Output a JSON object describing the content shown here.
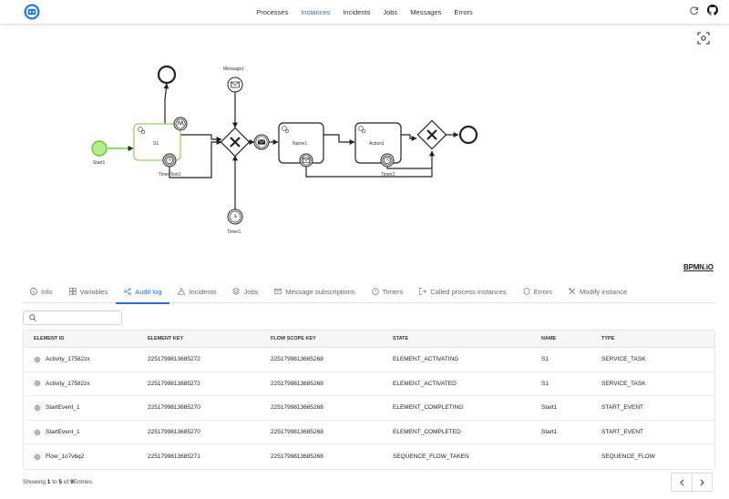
{
  "nav": {
    "links": [
      "Processes",
      "Instances",
      "Incidents",
      "Jobs",
      "Messages",
      "Errors"
    ],
    "active": "Instances",
    "icons": [
      "zeebe-logo-icon",
      "refresh-icon",
      "github-icon"
    ]
  },
  "diagram": {
    "labels": {
      "start1": "Start1",
      "s1": "S1",
      "timertest1": "TimerTest1",
      "message1": "Message1",
      "name1": "Name1",
      "action1": "Action1",
      "timer2": "Timer2",
      "timer1": "Timer1"
    },
    "watermark": "BPMN.iO",
    "active_color": "#52c41a"
  },
  "tabs": [
    {
      "label": "Info",
      "icon": "info-icon"
    },
    {
      "label": "Variables",
      "icon": "variables-icon"
    },
    {
      "label": "Audit log",
      "icon": "share-icon"
    },
    {
      "label": "Incidents",
      "icon": "warning-icon"
    },
    {
      "label": "Jobs",
      "icon": "jobs-icon"
    },
    {
      "label": "Message subscriptions",
      "icon": "mail-icon"
    },
    {
      "label": "Timers",
      "icon": "clock-icon"
    },
    {
      "label": "Called process instances",
      "icon": "external-icon"
    },
    {
      "label": "Errors",
      "icon": "shield-icon"
    },
    {
      "label": "Modify instance",
      "icon": "tools-icon"
    }
  ],
  "active_tab": "Audit log",
  "search": {
    "placeholder": "",
    "value": ""
  },
  "table": {
    "columns": [
      "ELEMENT ID",
      "ELEMENT KEY",
      "FLOW SCOPE KEY",
      "STATE",
      "NAME",
      "TYPE"
    ],
    "rows": [
      [
        "Activity_17582zx",
        "2251799813685272",
        "2251799813685268",
        "ELEMENT_ACTIVATING",
        "S1",
        "SERVICE_TASK"
      ],
      [
        "Activity_17582zx",
        "2251799813685272",
        "2251799813685268",
        "ELEMENT_ACTIVATED",
        "S1",
        "SERVICE_TASK"
      ],
      [
        "StartEvent_1",
        "2251799813685270",
        "2251799813685268",
        "ELEMENT_COMPLETING",
        "Start1",
        "START_EVENT"
      ],
      [
        "StartEvent_1",
        "2251799813685270",
        "2251799813685268",
        "ELEMENT_COMPLETED",
        "Start1",
        "START_EVENT"
      ],
      [
        "Flow_1o7v6q2",
        "2251799813685271",
        "2251799813685268",
        "SEQUENCE_FLOW_TAKEN",
        "",
        "SEQUENCE_FLOW"
      ]
    ]
  },
  "footer": {
    "prefix": "Showing",
    "from": "1",
    "to_word": "to",
    "to": "5",
    "of_word": "of",
    "total": "9",
    "suffix": "Entries"
  }
}
